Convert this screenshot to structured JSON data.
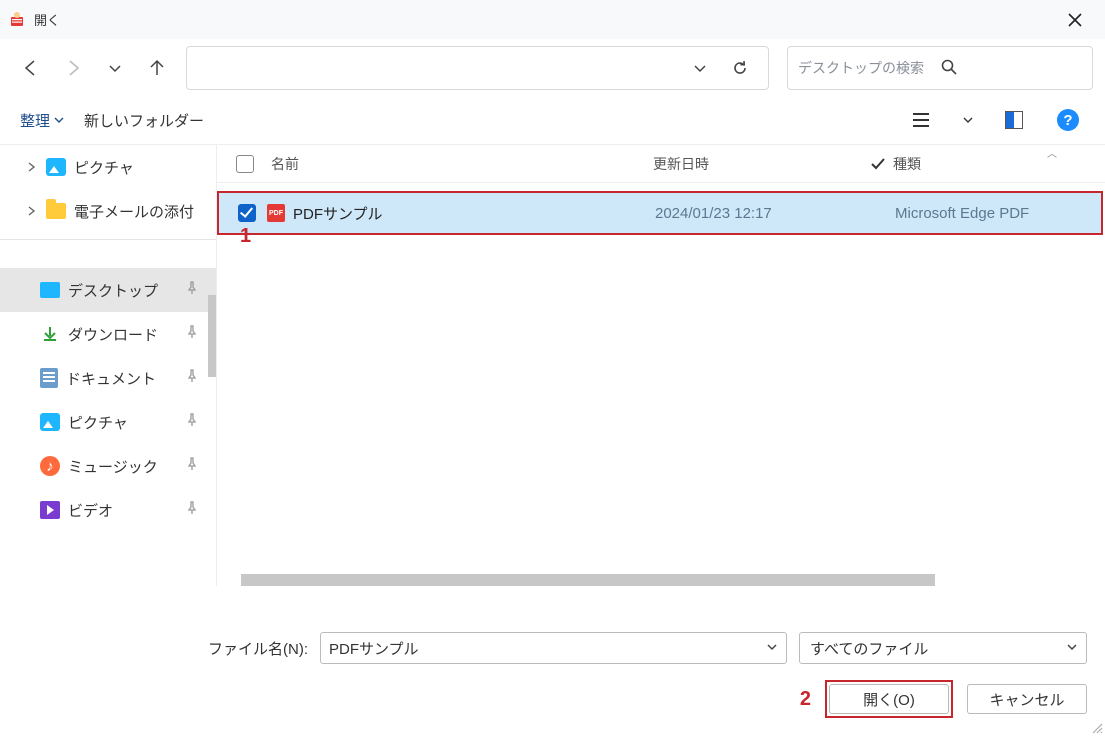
{
  "titlebar": {
    "title": "開く"
  },
  "search": {
    "placeholder": "デスクトップの検索"
  },
  "toolbar": {
    "organize": "整理",
    "newfolder": "新しいフォルダー"
  },
  "tree": {
    "pictures": "ピクチャ",
    "email_attachments": "電子メールの添付"
  },
  "sidebar": {
    "desktop": "デスクトップ",
    "downloads": "ダウンロード",
    "documents": "ドキュメント",
    "pictures": "ピクチャ",
    "music": "ミュージック",
    "videos": "ビデオ"
  },
  "columns": {
    "name": "名前",
    "modified": "更新日時",
    "type": "種類"
  },
  "file": {
    "name": "PDFサンプル",
    "modified": "2024/01/23 12:17",
    "type": "Microsoft Edge PDF"
  },
  "bottom": {
    "filename_label": "ファイル名(N):",
    "filename_value": "PDFサンプル",
    "filter": "すべてのファイル",
    "open": "開く(O)",
    "cancel": "キャンセル"
  },
  "annotations": {
    "one": "1",
    "two": "2"
  }
}
